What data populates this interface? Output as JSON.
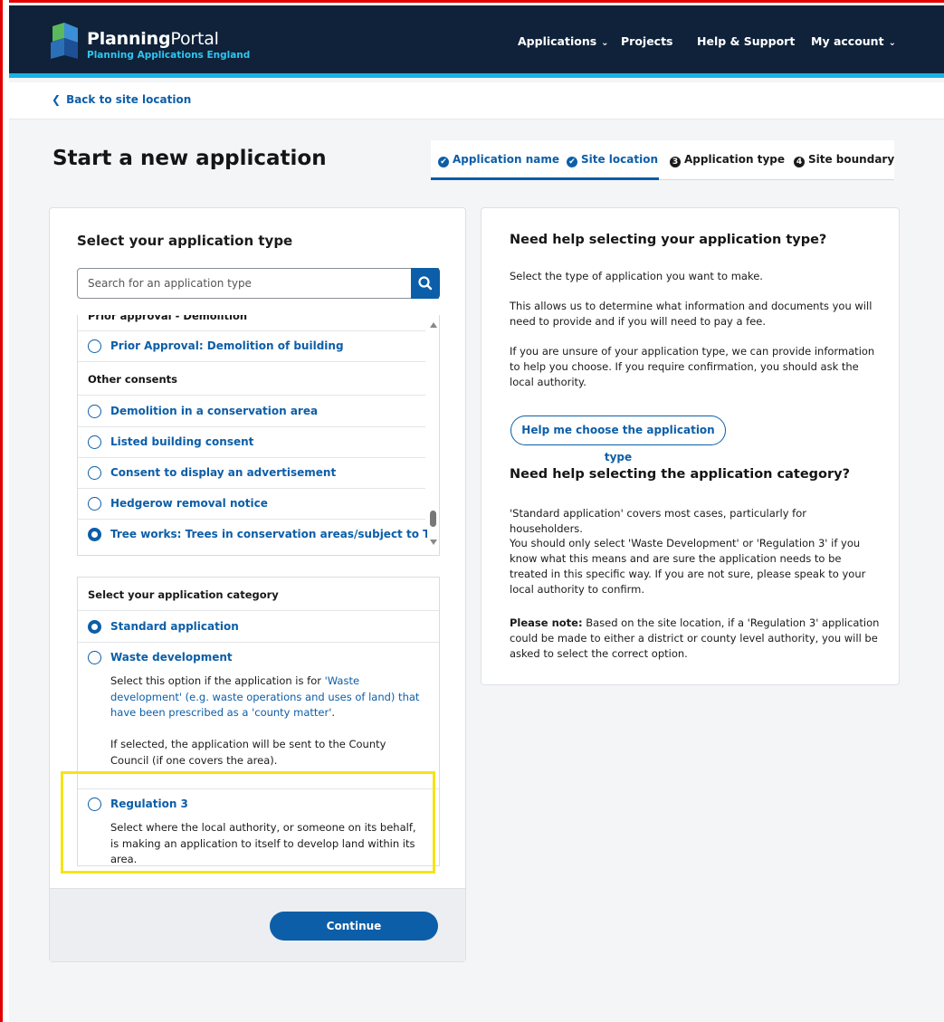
{
  "header": {
    "brand_bold": "Planning",
    "brand_rest": "Portal",
    "brand_sub": "Planning Applications England",
    "nav": {
      "applications": "Applications",
      "projects": "Projects",
      "help": "Help & Support",
      "account": "My account"
    },
    "colors": {
      "bar": "#0f223a",
      "accent": "#17b3e6"
    }
  },
  "back_link": "Back to site location",
  "page_title": "Start a new application",
  "stepper": {
    "steps": [
      {
        "label": "Application name",
        "state": "done",
        "marker": "✔"
      },
      {
        "label": "Site location",
        "state": "done",
        "marker": "✔"
      },
      {
        "label": "Application type",
        "state": "current",
        "marker": "3"
      },
      {
        "label": "Site boundary",
        "state": "todo",
        "marker": "4"
      }
    ]
  },
  "select_type": {
    "heading": "Select your application type",
    "search_placeholder": "Search for an application type",
    "groups": [
      {
        "heading": "Prior approval - Demolition",
        "items": [
          {
            "label": "Prior Approval: Demolition of building",
            "selected": false
          }
        ]
      },
      {
        "heading": "Other consents",
        "items": [
          {
            "label": "Demolition in a conservation area",
            "selected": false
          },
          {
            "label": "Listed building consent",
            "selected": false
          },
          {
            "label": "Consent to display an advertisement",
            "selected": false
          },
          {
            "label": "Hedgerow removal notice",
            "selected": false
          },
          {
            "label": "Tree works: Trees in conservation areas/subject to TPOs",
            "selected": true
          }
        ]
      }
    ]
  },
  "category": {
    "heading": "Select your application category",
    "options": [
      {
        "label": "Standard application",
        "selected": true
      },
      {
        "label": "Waste development",
        "selected": false,
        "desc_pre": "Select this option if the application is for ",
        "desc_link": "'Waste development' (e.g. waste operations and uses of land) that have been prescribed as a 'county matter'",
        "desc_post": ".",
        "desc2": "If selected, the application will be sent to the County Council (if one covers the area)."
      },
      {
        "label": "Regulation 3",
        "selected": false,
        "desc": "Select where the local authority, or someone on its behalf, is making an application to itself to develop land within its area."
      }
    ]
  },
  "continue_label": "Continue",
  "help": {
    "h1": "Need help selecting your application type?",
    "p1": "Select the type of application you want to make.",
    "p2": "This allows us to determine what information and documents you will need to provide and if you will need to pay a fee.",
    "p3": "If you are unsure of your application type, we can provide information to help you choose. If you require confirmation, you should ask the local authority.",
    "button": "Help me choose the application type",
    "h2": "Need help selecting the application category?",
    "p4": "'Standard application' covers most cases, particularly for householders.",
    "p5": "You should only select 'Waste Development' or 'Regulation 3' if you know what this means and are sure the application needs to be treated in this specific way. If you are not sure, please speak to your local authority to confirm.",
    "p6_bold": "Please note:",
    "p6": " Based on the site location, if a 'Regulation 3' application could be made to either a district or county level authority, you will be asked to select the correct option."
  }
}
